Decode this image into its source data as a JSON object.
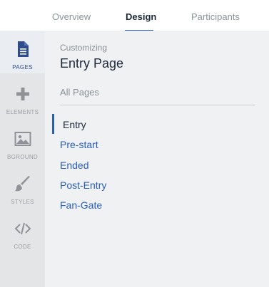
{
  "tabs": [
    {
      "label": "Overview",
      "active": false
    },
    {
      "label": "Design",
      "active": true
    },
    {
      "label": "Participants",
      "active": false
    }
  ],
  "rail": {
    "items": [
      {
        "label": "PAGES",
        "icon": "page-icon",
        "active": true
      },
      {
        "label": "ELEMENTS",
        "icon": "plus-icon",
        "active": false
      },
      {
        "label": "BGROUND",
        "icon": "image-icon",
        "active": false
      },
      {
        "label": "STYLES",
        "icon": "brush-icon",
        "active": false
      },
      {
        "label": "CODE",
        "icon": "code-icon",
        "active": false
      }
    ]
  },
  "panel": {
    "eyebrow": "Customizing",
    "title": "Entry Page",
    "all_pages": "All Pages",
    "pages": [
      {
        "label": "Entry",
        "selected": true
      },
      {
        "label": "Pre-start",
        "selected": false
      },
      {
        "label": "Ended",
        "selected": false
      },
      {
        "label": "Post-Entry",
        "selected": false
      },
      {
        "label": "Fan-Gate",
        "selected": false
      }
    ]
  },
  "colors": {
    "accent": "#2a5db9",
    "rail_bg": "#e4e5e6",
    "panel_bg": "#eff1f3",
    "active_tab_underline": "#2a64c9"
  }
}
